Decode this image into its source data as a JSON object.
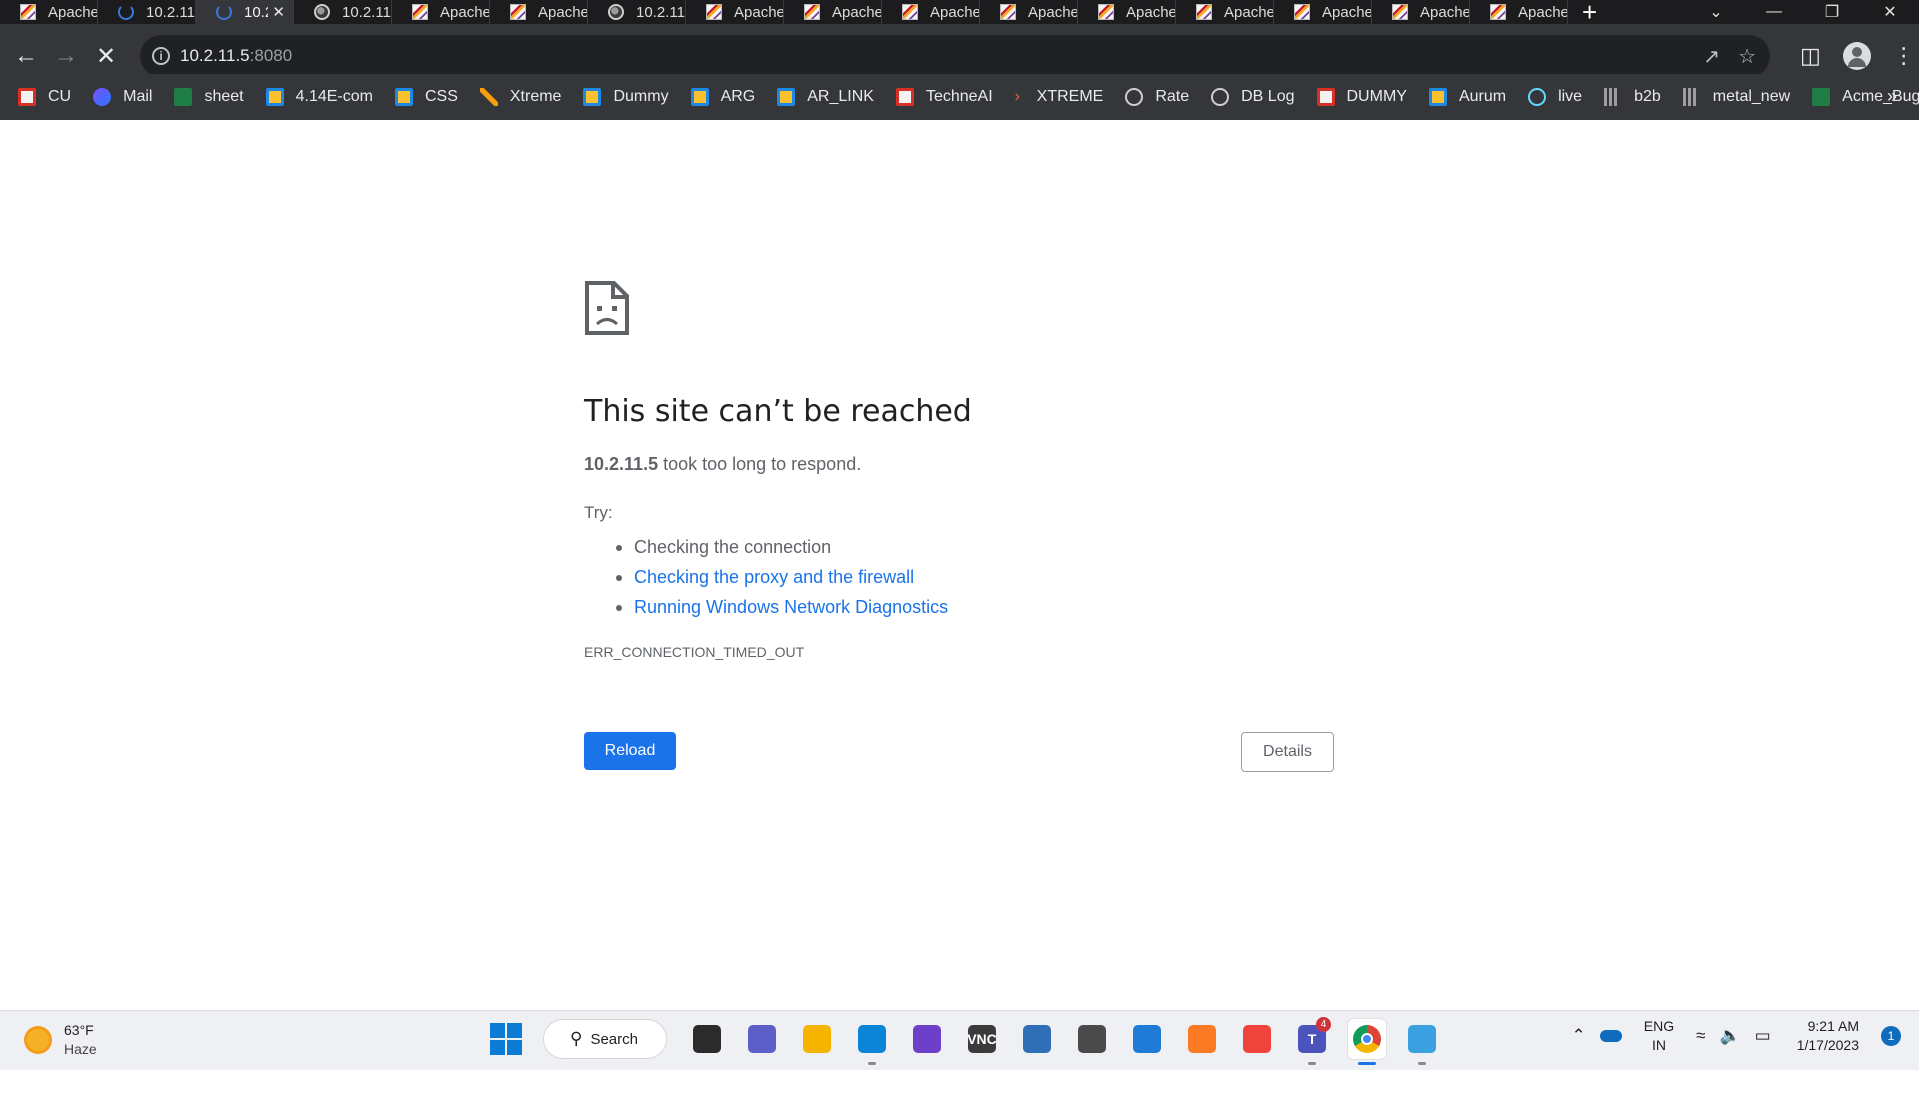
{
  "tabs": [
    {
      "title": "Apache",
      "icon": "apache-icon",
      "active": false
    },
    {
      "title": "10.2.11",
      "icon": "loading-spinner-icon",
      "active": false
    },
    {
      "title": "10.2",
      "icon": "loading-spinner-icon",
      "active": true
    },
    {
      "title": "10.2.11",
      "icon": "globe-icon",
      "active": false
    },
    {
      "title": "Apache",
      "icon": "apache-icon",
      "active": false
    },
    {
      "title": "Apache",
      "icon": "apache-icon",
      "active": false
    },
    {
      "title": "10.2.11",
      "icon": "globe-icon",
      "active": false
    },
    {
      "title": "Apache",
      "icon": "apache-icon",
      "active": false
    },
    {
      "title": "Apache",
      "icon": "apache-icon",
      "active": false
    },
    {
      "title": "Apache",
      "icon": "apache-icon",
      "active": false
    },
    {
      "title": "Apache",
      "icon": "apache-icon",
      "active": false
    },
    {
      "title": "Apache",
      "icon": "apache-icon",
      "active": false
    },
    {
      "title": "Apache",
      "icon": "apache-icon",
      "active": false
    },
    {
      "title": "Apache",
      "icon": "apache-icon",
      "active": false
    },
    {
      "title": "Apache",
      "icon": "apache-icon",
      "active": false
    },
    {
      "title": "Apache",
      "icon": "apache-icon",
      "active": false
    }
  ],
  "address": {
    "host": "10.2.11.5",
    "port": ":8080"
  },
  "bookmarks": [
    {
      "label": "CU",
      "icon": "red-square-icon"
    },
    {
      "label": "Mail",
      "icon": "copilot-icon"
    },
    {
      "label": "sheet",
      "icon": "excel-icon"
    },
    {
      "label": "4.14E-com",
      "icon": "blue-app-icon"
    },
    {
      "label": "CSS",
      "icon": "blue-app-icon"
    },
    {
      "label": "Xtreme",
      "icon": "x-logo-icon"
    },
    {
      "label": "Dummy",
      "icon": "blue-app-icon"
    },
    {
      "label": "ARG",
      "icon": "blue-app-icon"
    },
    {
      "label": "AR_LINK",
      "icon": "blue-app-icon"
    },
    {
      "label": "TechneAI",
      "icon": "red-square-icon"
    },
    {
      "label": "XTREME",
      "icon": "chevron-icon"
    },
    {
      "label": "Rate",
      "icon": "globe-icon"
    },
    {
      "label": "DB Log",
      "icon": "globe-icon"
    },
    {
      "label": "DUMMY",
      "icon": "red-square-icon"
    },
    {
      "label": "Aurum",
      "icon": "blue-app-icon"
    },
    {
      "label": "live",
      "icon": "react-icon"
    },
    {
      "label": "b2b",
      "icon": "bars-icon"
    },
    {
      "label": "metal_new",
      "icon": "bars-icon"
    },
    {
      "label": "Acme_Bug_ID's",
      "icon": "excel-icon"
    }
  ],
  "error": {
    "title": "This site can’t be reached",
    "host": "10.2.11.5",
    "desc_rest": " took too long to respond.",
    "try_label": "Try:",
    "suggestions": [
      {
        "text": "Checking the connection",
        "link": false
      },
      {
        "text": "Checking the proxy and the firewall",
        "link": true
      },
      {
        "text": "Running Windows Network Diagnostics",
        "link": true
      }
    ],
    "code": "ERR_CONNECTION_TIMED_OUT",
    "reload_label": "Reload",
    "details_label": "Details"
  },
  "taskbar": {
    "weather_temp": "63°F",
    "weather_cond": "Haze",
    "search_label": "Search",
    "apps": [
      {
        "name": "file-explorer-dark-icon",
        "color": "#2b2b2b",
        "glyph": "",
        "running": false
      },
      {
        "name": "teams-chat-icon",
        "color": "#5b5fc7",
        "glyph": "",
        "running": false
      },
      {
        "name": "folder-icon",
        "color": "#f4b400",
        "glyph": "",
        "running": false
      },
      {
        "name": "skype-icon",
        "color": "#0a84d6",
        "glyph": "",
        "running": true
      },
      {
        "name": "visual-studio-icon",
        "color": "#6e3fc8",
        "glyph": "",
        "running": false
      },
      {
        "name": "vnc-viewer-icon",
        "color": "#3b3b3b",
        "glyph": "VNC",
        "running": false
      },
      {
        "name": "network-computer-icon",
        "color": "#2e6fb5",
        "glyph": "",
        "running": false
      },
      {
        "name": "security-tool-icon",
        "color": "#4a4a4a",
        "glyph": "",
        "running": false
      },
      {
        "name": "arrow-app-icon",
        "color": "#1e7bd6",
        "glyph": "",
        "running": false
      },
      {
        "name": "xampp-icon",
        "color": "#fb7a24",
        "glyph": "",
        "running": false
      },
      {
        "name": "anydesk-icon",
        "color": "#ef443b",
        "glyph": "",
        "running": false
      },
      {
        "name": "teams-icon",
        "color": "#4b53bc",
        "glyph": "T",
        "running": true,
        "badge": "4"
      },
      {
        "name": "chrome-icon",
        "color": "#ffffff",
        "glyph": "",
        "running": true,
        "active": true
      },
      {
        "name": "paint-icon",
        "color": "#3aa0e0",
        "glyph": "",
        "running": true
      }
    ],
    "lang_top": "ENG",
    "lang_bottom": "IN",
    "time": "9:21 AM",
    "date": "1/17/2023",
    "notification_count": "1"
  }
}
